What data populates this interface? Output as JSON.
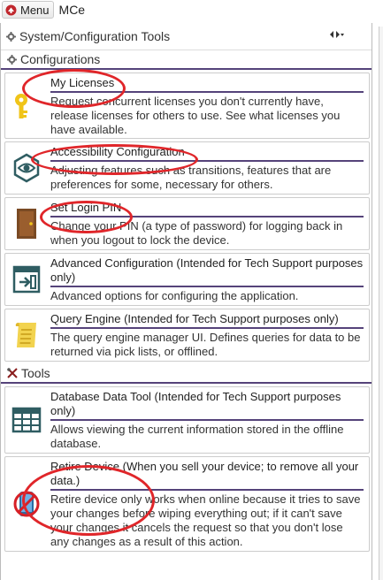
{
  "topbar": {
    "menu_label": "Menu",
    "app_name": "MCe"
  },
  "panel": {
    "title": "System/Configuration Tools",
    "collapse_icon": "collapse-toggle-icon"
  },
  "sections": {
    "configurations": {
      "label": "Configurations"
    },
    "tools": {
      "label": "Tools"
    }
  },
  "items": {
    "my_licenses": {
      "name": "My Licenses",
      "desc": "Request concurrent licenses you don't currently have, release licenses for others to use. See what licenses you have available.",
      "icon": "key-icon"
    },
    "accessibility": {
      "name": "Accessibility Configuration",
      "desc": "Adjusting features such as transitions, features that are preferences for some, necessary for others.",
      "icon": "eye-icon"
    },
    "login_pin": {
      "name": "Set Login PIN",
      "desc": "Change your PIN (a type of password) for logging back in when you logout to lock the device.",
      "icon": "door-icon"
    },
    "advanced": {
      "name": "Advanced Configuration (Intended for Tech Support purposes only)",
      "desc": "Advanced options for configuring the application.",
      "icon": "window-enter-icon"
    },
    "query_engine": {
      "name": "Query Engine (Intended for Tech Support purposes only)",
      "desc": "The query engine manager UI. Defines queries for data to be returned via pick lists, or offlined.",
      "icon": "scroll-icon"
    },
    "database_tool": {
      "name": "Database Data Tool (Intended for Tech Support purposes only)",
      "desc": "Allows viewing the current information stored in the offline database.",
      "icon": "table-grid-icon"
    },
    "retire_device": {
      "name": "Retire Device (When you sell your device; to remove all your data.)",
      "desc": "Retire device only works when online because it tries to save your changes before wiping everything out; if it can't save your changes it cancels the request so that you don't lose any changes as a result of this action.",
      "icon": "retire-device-icon"
    }
  },
  "colors": {
    "accent": "#55437a",
    "annotation": "#e0262a",
    "border": "#cccccc"
  }
}
